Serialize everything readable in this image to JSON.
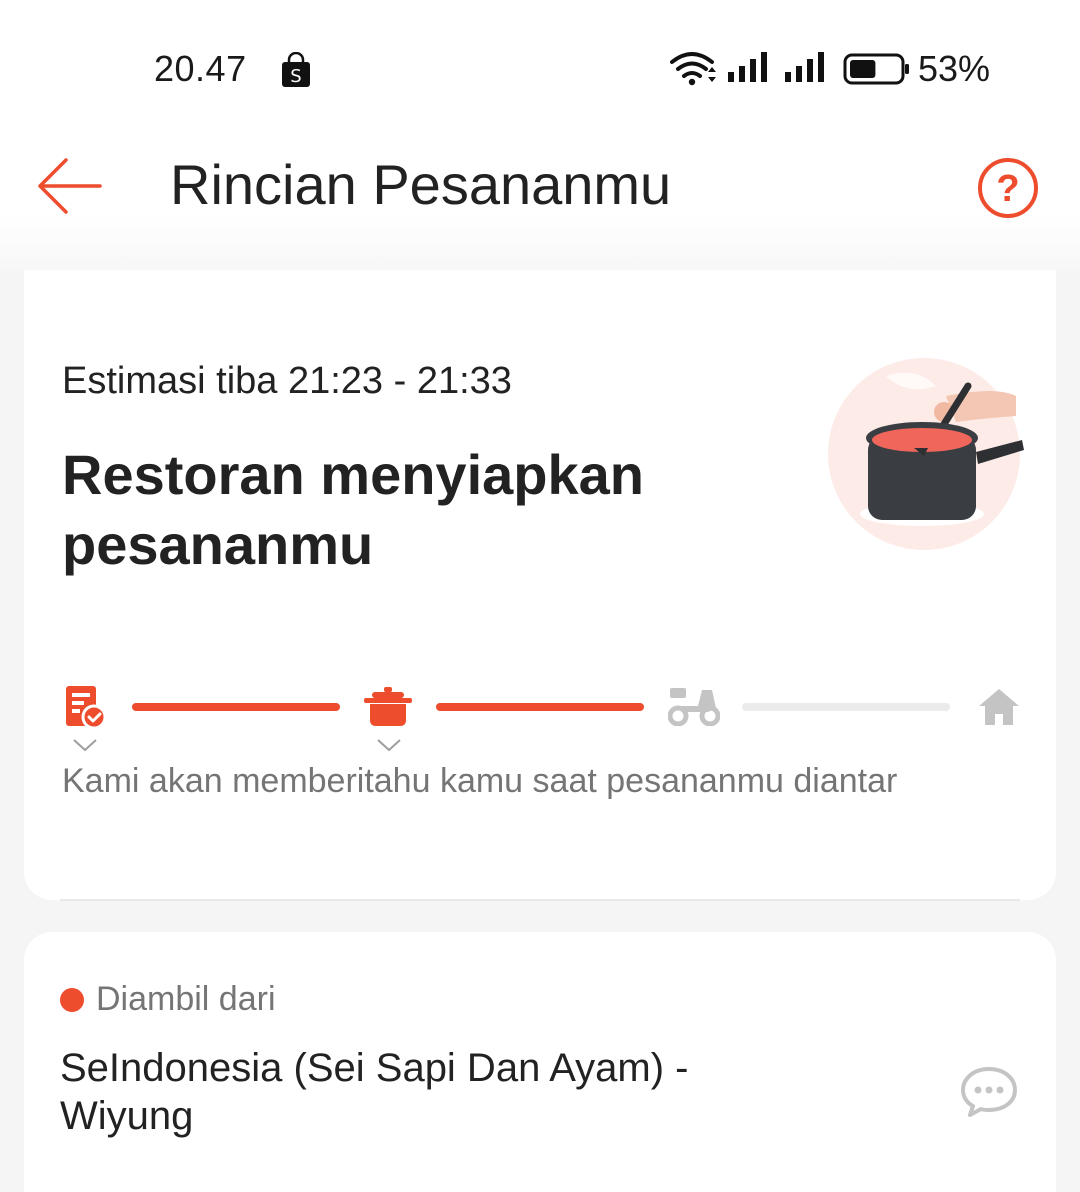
{
  "status_bar": {
    "time": "20.47",
    "battery_percent": "53%",
    "battery_level": 0.53,
    "icons": [
      "shopee-bag-icon",
      "wifi-icon",
      "signal-icon",
      "signal-icon",
      "battery-icon"
    ]
  },
  "header": {
    "title": "Rincian Pesananmu",
    "back_icon": "arrow-left-icon",
    "help_icon": "question-circle-icon"
  },
  "order_status": {
    "eta": "Estimasi tiba 21:23 - 21:33",
    "headline": "Restoran menyiapkan pesananmu",
    "illustration": "cooking-pot-illustration",
    "notify_text": "Kami akan memberitahu kamu saat pesananmu diantar",
    "steps": [
      {
        "icon": "receipt-check-icon",
        "active": true
      },
      {
        "icon": "cooking-pot-icon",
        "active": true
      },
      {
        "icon": "motorbike-icon",
        "active": false
      },
      {
        "icon": "home-icon",
        "active": false
      }
    ]
  },
  "pickup": {
    "label": "Diambil dari",
    "restaurant_name": "SeIndonesia (Sei Sapi Dan Ayam) - Wiyung",
    "chat_icon": "chat-bubble-icon"
  },
  "colors": {
    "accent": "#ee4d2d",
    "inactive": "#bdbdbd",
    "text_primary": "#222222",
    "text_secondary": "#757575",
    "background": "#f5f5f5"
  }
}
